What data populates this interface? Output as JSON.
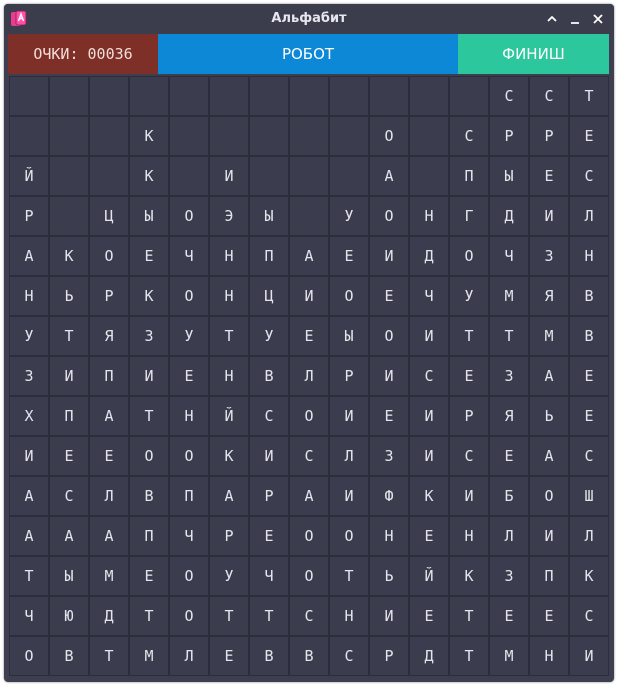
{
  "window": {
    "title": "Альфабит",
    "icon": "app-logo-icon",
    "controls": [
      "maximize-icon",
      "minimize-icon",
      "close-icon"
    ]
  },
  "toolbar": {
    "score_label": "ОЧКИ: 00036",
    "robot_label": "РОБОТ",
    "finish_label": "ФИНИШ"
  },
  "colors": {
    "score_bg": "#7e2f27",
    "robot_bg": "#0c88d6",
    "finish_bg": "#2cc79c",
    "cell_bg": "#3b3d4f"
  },
  "board": {
    "rows": [
      [
        "",
        "",
        "",
        "",
        "",
        "",
        "",
        "",
        "",
        "",
        "",
        "",
        "С",
        "С",
        "Т"
      ],
      [
        "",
        "",
        "",
        "К",
        "",
        "",
        "",
        "",
        "",
        "О",
        "",
        "С",
        "Р",
        "Р",
        "Е"
      ],
      [
        "Й",
        "",
        "",
        "К",
        "",
        "И",
        "",
        "",
        "",
        "А",
        "",
        "П",
        "Ы",
        "Е",
        "С"
      ],
      [
        "Р",
        "",
        "Ц",
        "Ы",
        "О",
        "Э",
        "Ы",
        "",
        "У",
        "О",
        "Н",
        "Г",
        "Д",
        "И",
        "Л"
      ],
      [
        "А",
        "К",
        "О",
        "Е",
        "Ч",
        "Н",
        "П",
        "А",
        "Е",
        "И",
        "Д",
        "О",
        "Ч",
        "З",
        "Н"
      ],
      [
        "Н",
        "Ь",
        "Р",
        "К",
        "О",
        "Н",
        "Ц",
        "И",
        "О",
        "Е",
        "Ч",
        "У",
        "М",
        "Я",
        "В"
      ],
      [
        "У",
        "Т",
        "Я",
        "З",
        "У",
        "Т",
        "У",
        "Е",
        "Ы",
        "О",
        "И",
        "Т",
        "Т",
        "М",
        "В"
      ],
      [
        "З",
        "И",
        "П",
        "И",
        "Е",
        "Н",
        "В",
        "Л",
        "Р",
        "И",
        "С",
        "Е",
        "З",
        "А",
        "Е"
      ],
      [
        "Х",
        "П",
        "А",
        "Т",
        "Н",
        "Й",
        "С",
        "О",
        "И",
        "Е",
        "И",
        "Р",
        "Я",
        "Ь",
        "Е"
      ],
      [
        "И",
        "Е",
        "Е",
        "О",
        "О",
        "К",
        "И",
        "С",
        "Л",
        "З",
        "И",
        "С",
        "Е",
        "А",
        "С"
      ],
      [
        "А",
        "С",
        "Л",
        "В",
        "П",
        "А",
        "Р",
        "А",
        "И",
        "Ф",
        "К",
        "И",
        "Б",
        "О",
        "Ш"
      ],
      [
        "А",
        "А",
        "А",
        "П",
        "Ч",
        "Р",
        "Е",
        "О",
        "О",
        "Н",
        "Е",
        "Н",
        "Л",
        "И",
        "Л"
      ],
      [
        "Т",
        "Ы",
        "М",
        "Е",
        "О",
        "У",
        "Ч",
        "О",
        "Т",
        "Ь",
        "Й",
        "К",
        "З",
        "П",
        "К"
      ],
      [
        "Ч",
        "Ю",
        "Д",
        "Т",
        "О",
        "Т",
        "Т",
        "С",
        "Н",
        "И",
        "Е",
        "Т",
        "Е",
        "Е",
        "С"
      ],
      [
        "О",
        "В",
        "Т",
        "М",
        "Л",
        "Е",
        "В",
        "В",
        "С",
        "Р",
        "Д",
        "Т",
        "М",
        "Н",
        "И"
      ]
    ]
  }
}
